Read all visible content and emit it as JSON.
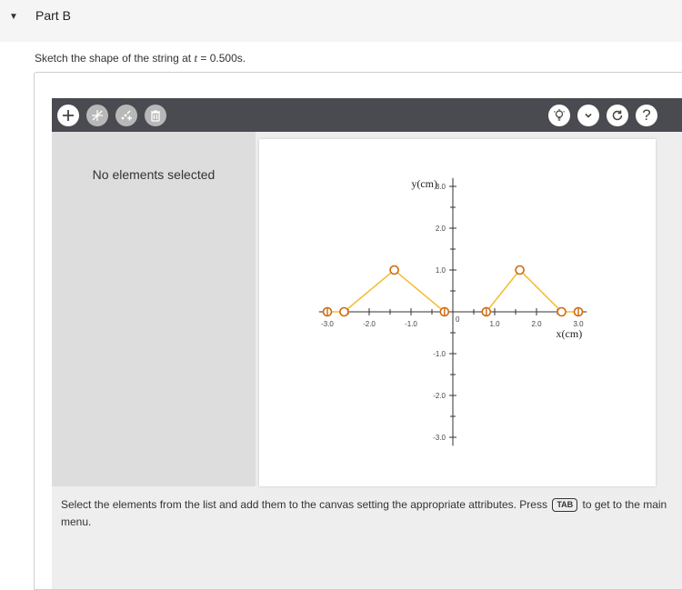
{
  "part": {
    "toggle_icon": "caret-down",
    "title": "Part B"
  },
  "question": {
    "prefix": "Sketch the shape of the string at ",
    "variable": "t",
    "suffix": " = 0.500s."
  },
  "toolbar": {
    "left_tools": [
      "add-point-icon",
      "vector-tool-icon",
      "edit-tool-icon",
      "trash-icon"
    ],
    "right_tools": [
      "hint-icon",
      "chevron-down-icon",
      "reset-icon",
      "help-icon"
    ],
    "help_label": "?"
  },
  "sidebar": {
    "status": "No elements selected"
  },
  "instructions": {
    "before_key": "Select the elements from the list and add them to the canvas setting the appropriate attributes. Press",
    "key": "TAB",
    "after_key": "to get to the main menu."
  },
  "chart_data": {
    "type": "line",
    "xlabel": "x(cm)",
    "ylabel": "y(cm)",
    "xlim": [
      -3.2,
      3.2
    ],
    "ylim": [
      -3.2,
      3.2
    ],
    "x_ticks": [
      -3.0,
      -2.0,
      -1.0,
      1.0,
      2.0,
      3.0
    ],
    "x_tick_labels": [
      "-3.0",
      "-2.0",
      "-1.0",
      "1.0",
      "2.0",
      "3.0"
    ],
    "y_ticks": [
      3.0,
      2.0,
      1.0,
      -1.0,
      -2.0,
      -3.0
    ],
    "y_tick_labels": [
      "3.0",
      "2.0",
      "1.0",
      "-1.0",
      "-2.0",
      "-3.0"
    ],
    "origin_label": "0",
    "series": [
      {
        "x": [
          -3.0,
          -2.6,
          -1.4,
          -0.2
        ],
        "y": [
          0,
          0,
          1.0,
          0
        ]
      },
      {
        "x": [
          0.8,
          1.6,
          2.6,
          3.0
        ],
        "y": [
          0,
          1.0,
          0,
          0
        ]
      }
    ],
    "line_color": "#f3c03a",
    "point_color": "#cc6a10"
  }
}
